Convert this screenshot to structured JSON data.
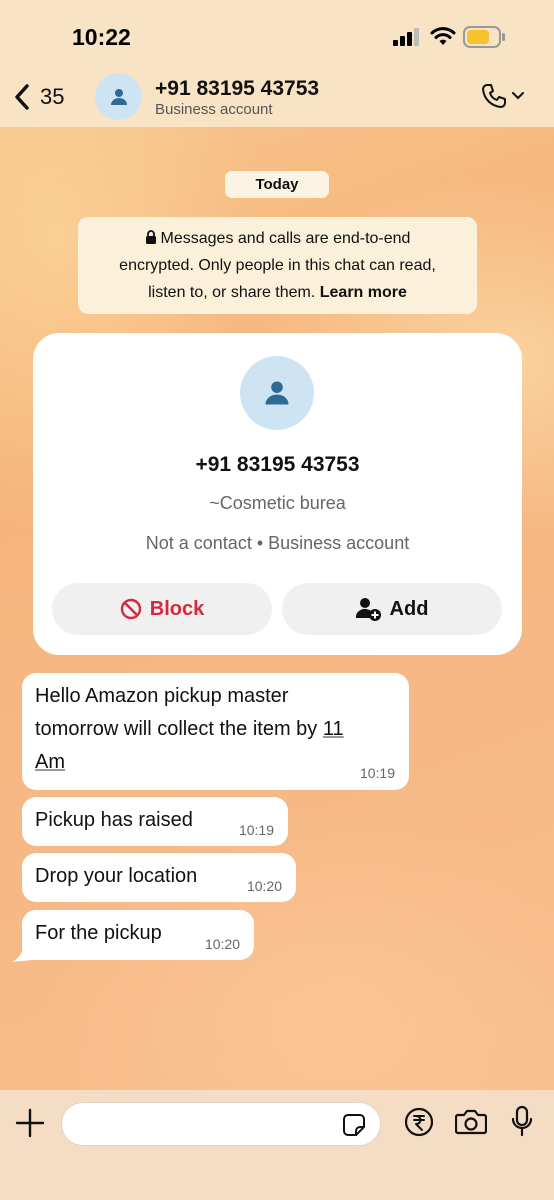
{
  "status_bar": {
    "time": "10:22"
  },
  "header": {
    "back_count": "35",
    "name": "+91 83195 43753",
    "subtitle": "Business account"
  },
  "date_chip": "Today",
  "encryption": {
    "text": "Messages and calls are end-to-end encrypted. Only people in this chat can read, listen to, or share them.",
    "line1": "Messages and calls are end-to-end",
    "line2": "encrypted. Only people in this chat can read,",
    "line3": "listen to, or share them.",
    "link": "Learn more"
  },
  "contact_card": {
    "name": "+91 83195 43753",
    "alias": "~Cosmetic burea",
    "meta": "Not a contact • Business account",
    "block_label": "Block",
    "add_label": "Add"
  },
  "messages": [
    {
      "line1": "Hello Amazon pickup master",
      "line2": "tomorrow will collect the item by ",
      "num": "11",
      "line3": "Am",
      "time": "10:19"
    },
    {
      "text": "Pickup has raised",
      "time": "10:19"
    },
    {
      "text": "Drop your location",
      "time": "10:20"
    },
    {
      "text": "For the pickup",
      "time": "10:20"
    }
  ],
  "composer": {
    "placeholder": ""
  },
  "colors": {
    "block_red": "#d62a3c",
    "avatar_bg": "#cfe4f2",
    "avatar_fg": "#2d6b94"
  }
}
